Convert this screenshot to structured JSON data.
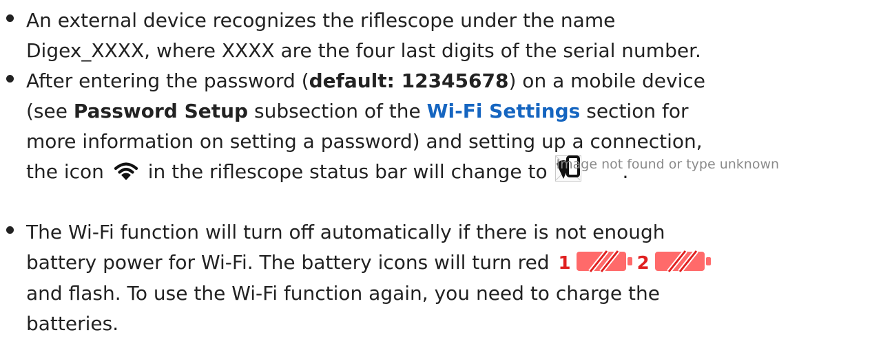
{
  "bullets": [
    {
      "line1": "An external device recognizes the riflescope under the name",
      "line2": "Digex_XXXX, where XXXX are the four last digits of the serial number."
    },
    {
      "text_before_password": "After entering the password (",
      "password_default": "default: 12345678",
      "text_after_password": ") on a mobile device",
      "text_see": "(see ",
      "password_setup": "Password Setup",
      "text_subsection": " subsection of the ",
      "wifi_settings_link": "Wi-Fi Settings",
      "text_section_for": " section for",
      "line3": "more information on setting a password) and setting up a connection,",
      "text_the_icon": "the icon ",
      "text_status_bar": " in the riflescope status bar will change to ",
      "broken_image_alt": "Image not found or type unknown",
      "text_period": "."
    },
    {
      "line1": "The Wi-Fi function will turn off automatically if there is not enough",
      "text_battery_before": "battery power for Wi-Fi. The battery icons will turn red ",
      "battery_1_label": "1",
      "battery_2_label": "2",
      "line3": "and flash. To use the Wi-Fi function again, you need to charge the",
      "line4": "batteries."
    }
  ],
  "icons": {
    "wifi": "wifi-icon",
    "phone_wifi": "phone-wifi-icon",
    "battery": "battery-empty-icon",
    "broken_image": "broken-image-icon"
  },
  "colors": {
    "text": "#222222",
    "link": "#1565c0",
    "battery_red": "#ff6a6a",
    "battery_stroke": "#e02020",
    "label_red": "#e02020"
  }
}
